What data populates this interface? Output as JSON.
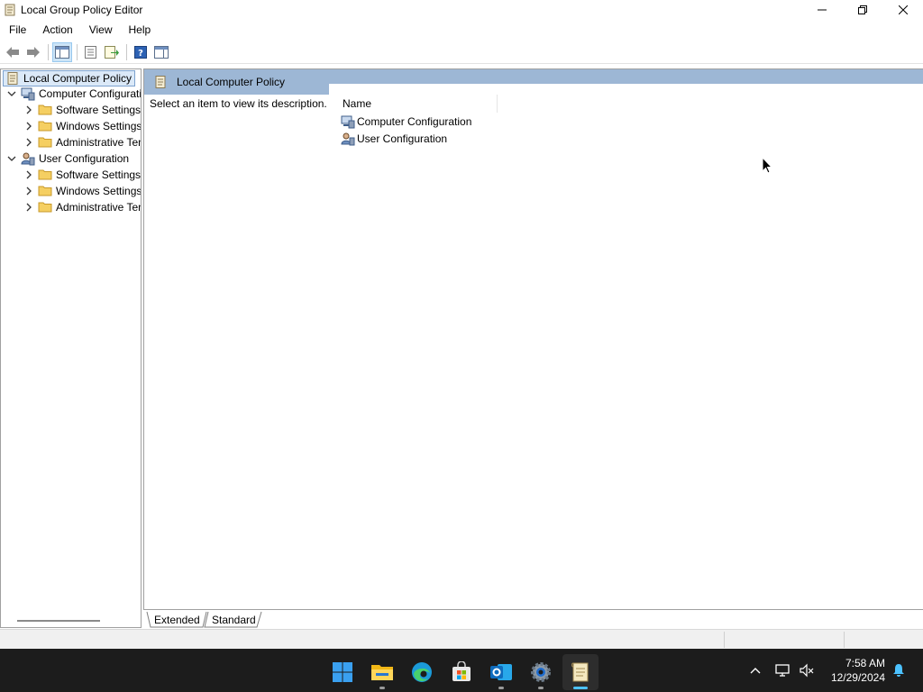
{
  "window": {
    "title": "Local Group Policy Editor",
    "icon": "policy-scroll-icon"
  },
  "menu": [
    "File",
    "Action",
    "View",
    "Help"
  ],
  "tree": {
    "root": "Local Computer Policy",
    "items": [
      {
        "label": "Computer Configuration",
        "level": 1,
        "expanded": true,
        "icon": "computer-config-icon"
      },
      {
        "label": "Software Settings",
        "level": 2,
        "expanded": false,
        "icon": "folder-icon"
      },
      {
        "label": "Windows Settings",
        "level": 2,
        "expanded": false,
        "icon": "folder-icon"
      },
      {
        "label": "Administrative Templates",
        "level": 2,
        "expanded": false,
        "icon": "folder-icon"
      },
      {
        "label": "User Configuration",
        "level": 1,
        "expanded": true,
        "icon": "user-config-icon"
      },
      {
        "label": "Software Settings",
        "level": 2,
        "expanded": false,
        "icon": "folder-icon"
      },
      {
        "label": "Windows Settings",
        "level": 2,
        "expanded": false,
        "icon": "folder-icon"
      },
      {
        "label": "Administrative Templates",
        "level": 2,
        "expanded": false,
        "icon": "folder-icon"
      }
    ]
  },
  "main": {
    "header_title": "Local Computer Policy",
    "description": "Select an item to view its description.",
    "column_name": "Name",
    "items": [
      {
        "label": "Computer Configuration",
        "icon": "computer-config-icon"
      },
      {
        "label": "User Configuration",
        "icon": "user-config-icon"
      }
    ]
  },
  "tabs": [
    "Extended",
    "Standard"
  ],
  "taskbar": {
    "apps": [
      "start-icon",
      "file-explorer-icon",
      "edge-icon",
      "store-icon",
      "outlook-icon",
      "settings-icon",
      "group-policy-icon"
    ],
    "time": "7:58 AM",
    "date": "12/29/2024"
  },
  "colors": {
    "header_band": "#9db7d5",
    "selection": "#dbe9f8",
    "taskbar": "#1c1c1c",
    "accent": "#4cc2ff"
  }
}
